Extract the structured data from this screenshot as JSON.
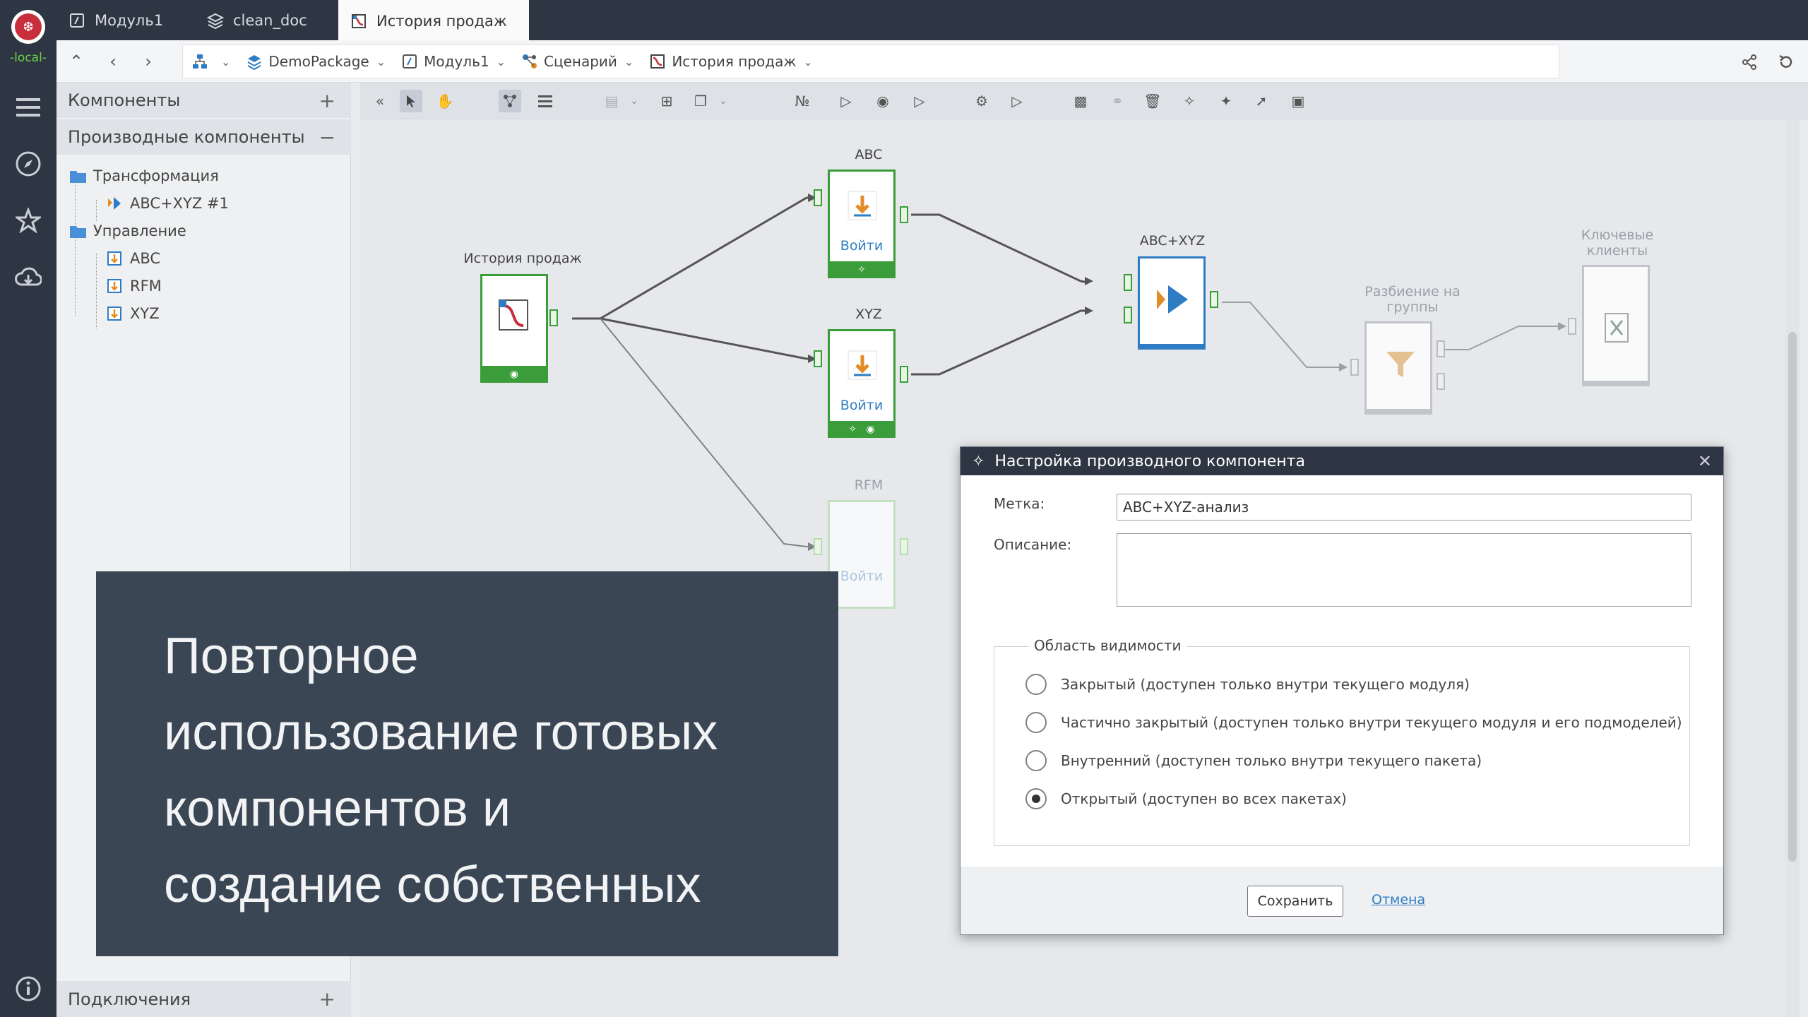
{
  "rail": {
    "local_label": "-local-"
  },
  "tabs": [
    {
      "label": "Модуль1"
    },
    {
      "label": "clean_doc"
    },
    {
      "label": "История продаж"
    }
  ],
  "breadcrumbs": [
    {
      "label": ""
    },
    {
      "label": "DemoPackage"
    },
    {
      "label": "Модуль1"
    },
    {
      "label": "Сценарий"
    },
    {
      "label": "История продаж"
    }
  ],
  "left_panel": {
    "components_header": "Компоненты",
    "derived_header": "Производные компоненты",
    "tree": {
      "transform_folder": "Трансформация",
      "transform_item": "ABC+XYZ #1",
      "control_folder": "Управление",
      "control_items": [
        "ABC",
        "RFM",
        "XYZ"
      ]
    },
    "connections_header": "Подключения"
  },
  "canvas": {
    "nodes": {
      "sales_history": {
        "label": "История продаж"
      },
      "abc": {
        "label": "ABC",
        "action": "Войти"
      },
      "xyz": {
        "label": "XYZ",
        "action": "Войти"
      },
      "rfm": {
        "label": "RFM",
        "action": "Войти"
      },
      "abcxyz": {
        "label": "ABC+XYZ"
      },
      "split": {
        "label_line1": "Разбиение на",
        "label_line2": "группы"
      },
      "key_clients": {
        "label_line1": "Ключевые",
        "label_line2": "клиенты"
      }
    }
  },
  "dialog": {
    "title": "Настройка производного компонента",
    "label_field": {
      "label": "Метка:",
      "value": "ABC+XYZ-анализ"
    },
    "description_field": {
      "label": "Описание:",
      "value": ""
    },
    "visibility": {
      "legend": "Область видимости",
      "options": [
        {
          "label": "Закрытый (доступен только внутри текущего модуля)",
          "selected": false
        },
        {
          "label": "Частично закрытый (доступен только внутри текущего модуля и его подмоделей)",
          "selected": false
        },
        {
          "label": "Внутренний (доступен только внутри текущего пакета)",
          "selected": false
        },
        {
          "label": "Открытый (доступен во всех пакетах)",
          "selected": true
        }
      ]
    },
    "save_label": "Сохранить",
    "cancel_label": "Отмена"
  },
  "caption": {
    "line1": "Повторное",
    "line2": "использование готовых",
    "line3": "компонентов и",
    "line4": "создание собственных"
  }
}
